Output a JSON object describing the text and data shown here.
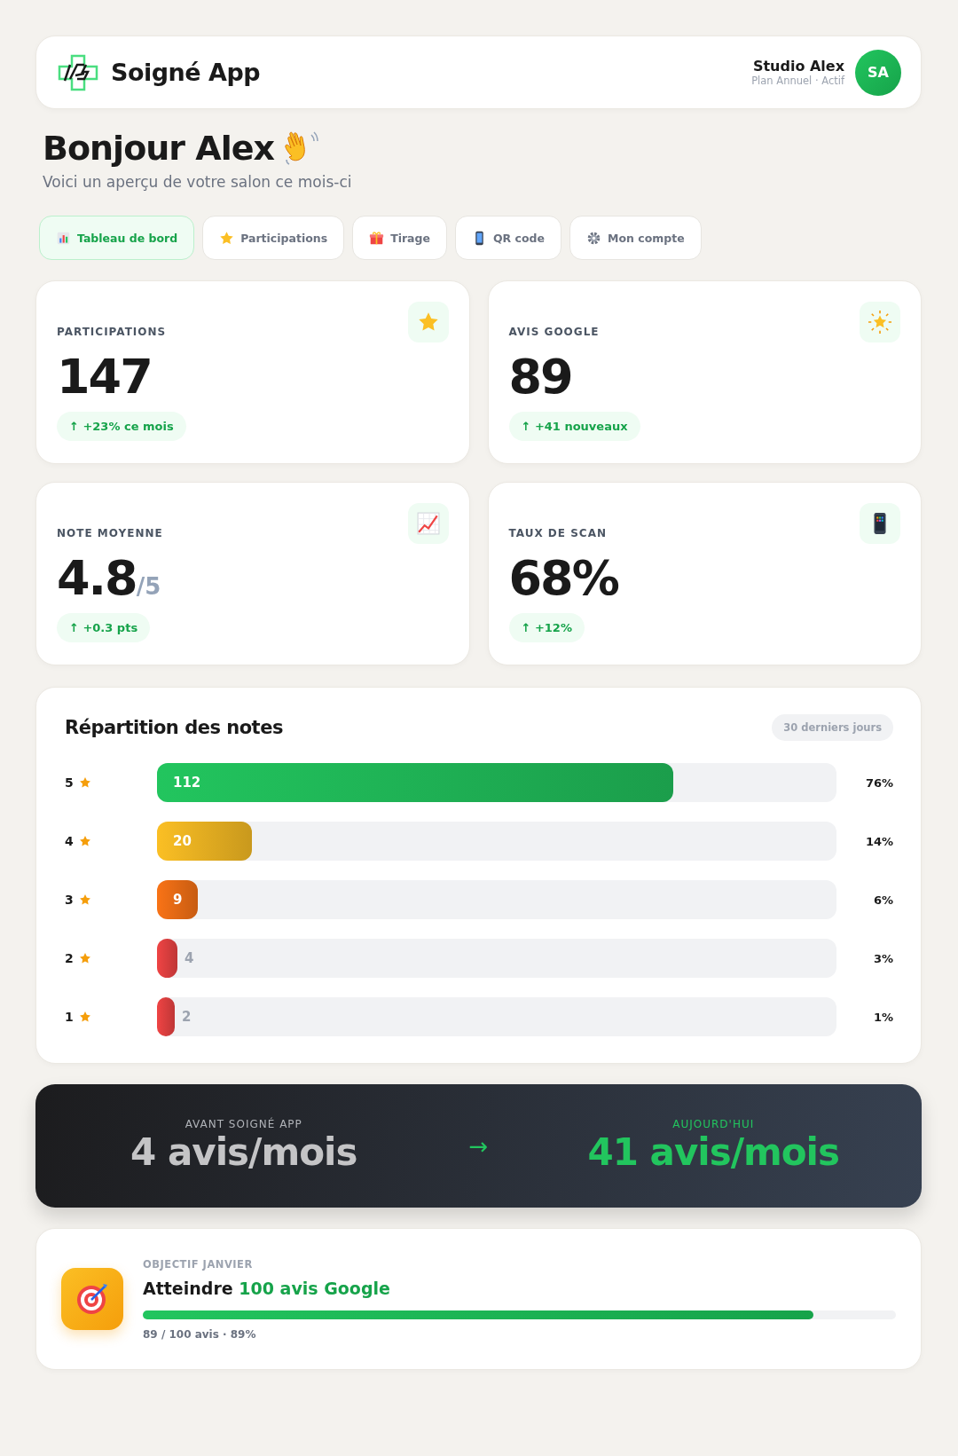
{
  "header": {
    "app_name": "Soigné App",
    "account_name": "Studio Alex",
    "account_plan": "Plan Annuel · Actif",
    "avatar_initials": "SA"
  },
  "greeting": {
    "title": "Bonjour Alex",
    "subtitle": "Voici un aperçu de votre salon ce mois-ci"
  },
  "tabs": [
    {
      "label": "Tableau de bord",
      "selected": true
    },
    {
      "label": "Participations",
      "selected": false
    },
    {
      "label": "Tirage",
      "selected": false
    },
    {
      "label": "QR code",
      "selected": false
    },
    {
      "label": "Mon compte",
      "selected": false
    }
  ],
  "stats": [
    {
      "label": "PARTICIPATIONS",
      "value": "147",
      "change": "↑ +23% ce mois"
    },
    {
      "label": "AVIS GOOGLE",
      "value": "89",
      "change": "↑ +41 nouveaux"
    },
    {
      "label": "NOTE MOYENNE",
      "value": "4.8",
      "suffix": "/5",
      "change": "↑ +0.3 pts"
    },
    {
      "label": "TAUX DE SCAN",
      "value": "68%",
      "change": "↑ +12%"
    }
  ],
  "distribution": {
    "title": "Répartition des notes",
    "period": "30 derniers jours",
    "rows": [
      {
        "rating": "5",
        "count": "112",
        "percent": "76%",
        "level": 0.76,
        "color": "#22c55e"
      },
      {
        "rating": "4",
        "count": "20",
        "percent": "14%",
        "level": 0.14,
        "color": "#fbbf24"
      },
      {
        "rating": "3",
        "count": "9",
        "percent": "6%",
        "level": 0.06,
        "color": "#f97316"
      },
      {
        "rating": "2",
        "count": "4",
        "percent": "3%",
        "level": 0.03,
        "color": "#ef4444"
      },
      {
        "rating": "1",
        "count": "2",
        "percent": "1%",
        "level": 0.01,
        "color": "#ef4444"
      }
    ]
  },
  "comparison": {
    "before_label": "AVANT SOIGNÉ APP",
    "before_value": "4 avis/mois",
    "arrow": "→",
    "after_label": "AUJOURD'HUI",
    "after_value": "41 avis/mois"
  },
  "goal": {
    "label": "OBJECTIF JANVIER",
    "title": "Atteindre",
    "highlight": "100 avis Google",
    "level": 0.89,
    "progress": "89 / 100 avis · 89%"
  }
}
